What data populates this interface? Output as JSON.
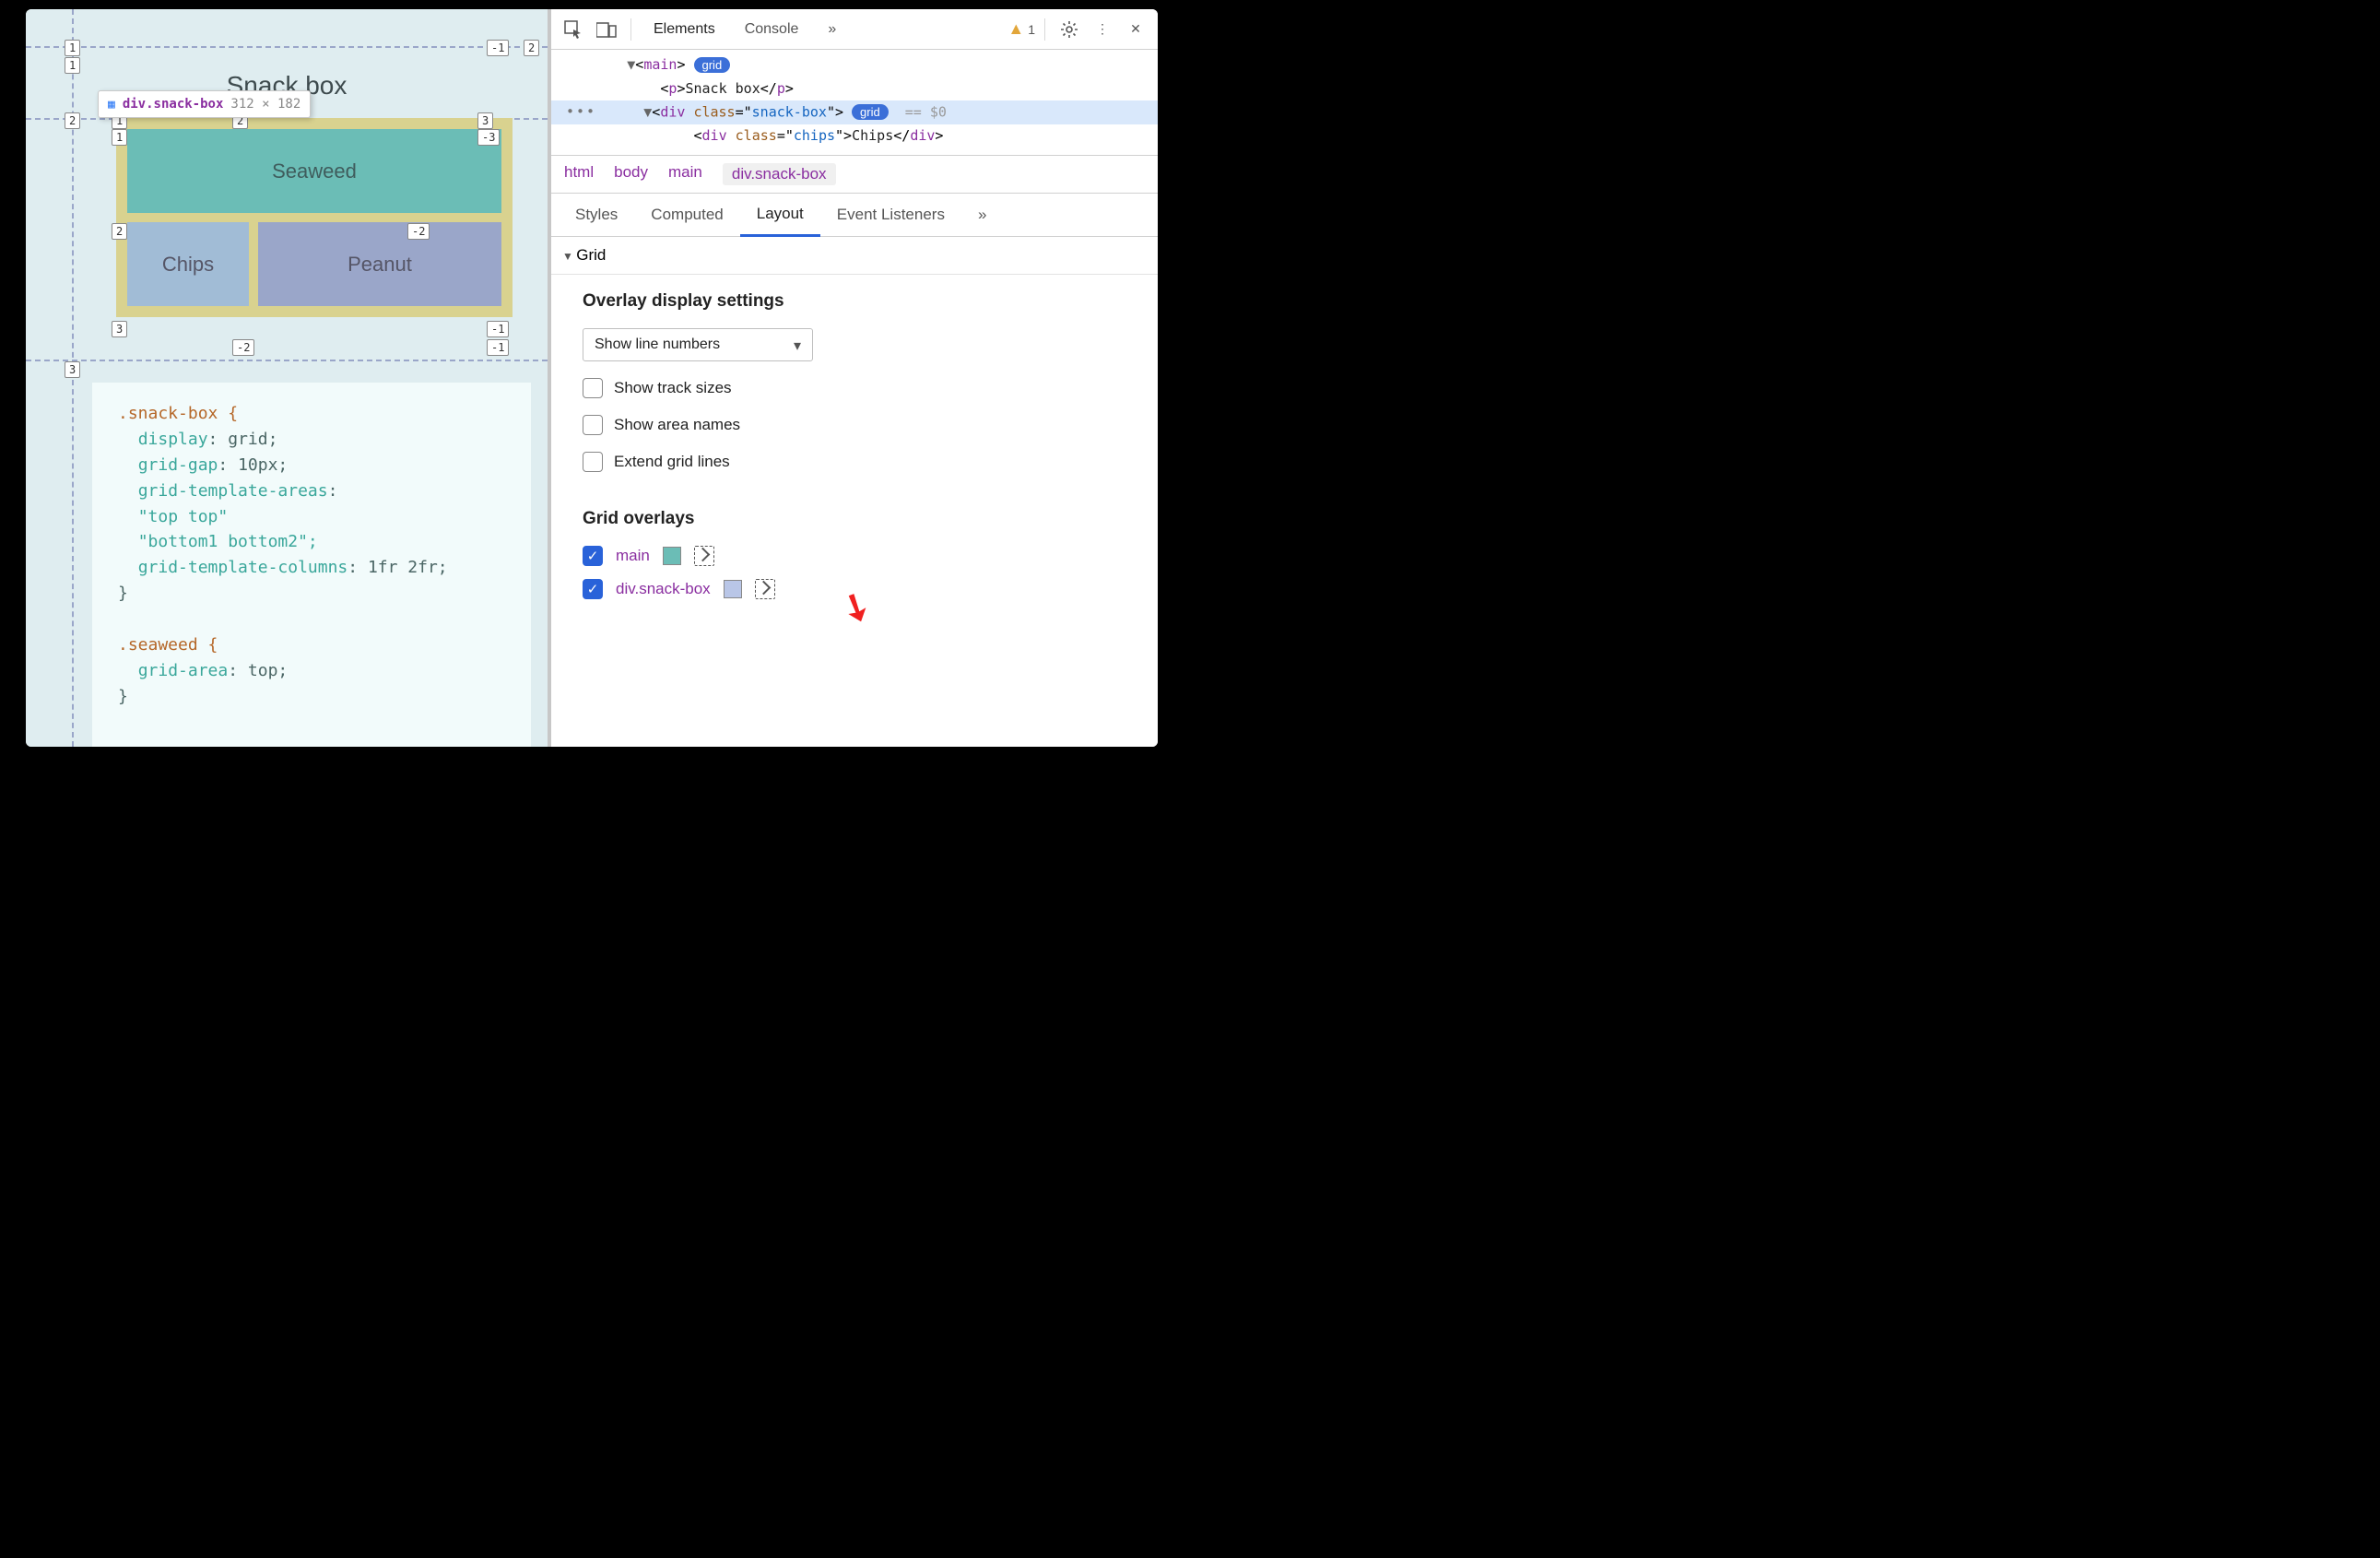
{
  "viewport": {
    "title": "Snack box",
    "tooltip": {
      "selector": "div.snack-box",
      "dimensions": "312 × 182"
    },
    "cells": {
      "seaweed": "Seaweed",
      "chips": "Chips",
      "peanut": "Peanut"
    },
    "line_labels": {
      "outer_top_left": "1",
      "outer_top_right_neg": "-1",
      "outer_top_right": "2",
      "outer_mid_left": "2",
      "outer_bot_left": "3",
      "grid_top_left": "1",
      "grid_top_mid": "2",
      "grid_top_right_pos": "3",
      "grid_top_right_neg": "-3",
      "grid_left_1": "1",
      "grid_left_2": "2",
      "grid_left_3": "3",
      "grid_right_neg3": "-3",
      "grid_right_neg2": "-2",
      "grid_right_neg1": "-1",
      "grid_bot_mid_neg2": "-2",
      "grid_bot_right_neg1": "-1"
    },
    "code": {
      "l1": ".snack-box {",
      "p1": "display",
      "v1": "grid;",
      "p2": "grid-gap",
      "v2": "10px;",
      "p3": "grid-template-areas",
      "v3": ":",
      "s1": "\"top top\"",
      "s2": "\"bottom1 bottom2\";",
      "p4": "grid-template-columns",
      "v4": "1fr 2fr;",
      "l2": "}",
      "l3": ".seaweed {",
      "p5": "grid-area",
      "v5": "top;",
      "l4": "}"
    }
  },
  "devtools": {
    "tabs": {
      "elements": "Elements",
      "console": "Console"
    },
    "warning_count": "1",
    "dom": {
      "main_tag": "main",
      "grid_badge": "grid",
      "p_tag": "p",
      "p_text": "Snack box",
      "div_tag": "div",
      "class_attr": "class",
      "snackbox_val": "snack-box",
      "eq_dollar": "== $0",
      "chips_val": "chips",
      "chips_text": "Chips"
    },
    "crumbs": [
      "html",
      "body",
      "main",
      "div.snack-box"
    ],
    "subtabs": {
      "styles": "Styles",
      "computed": "Computed",
      "layout": "Layout",
      "listeners": "Event Listeners"
    },
    "grid_section": "Grid",
    "overlay_settings": {
      "title": "Overlay display settings",
      "select": "Show line numbers",
      "track_sizes": "Show track sizes",
      "area_names": "Show area names",
      "extend_lines": "Extend grid lines"
    },
    "grid_overlays": {
      "title": "Grid overlays",
      "items": [
        {
          "name": "main",
          "swatch": "#6bbdb6"
        },
        {
          "name": "div.snack-box",
          "swatch": "#b9c6e7"
        }
      ]
    }
  }
}
